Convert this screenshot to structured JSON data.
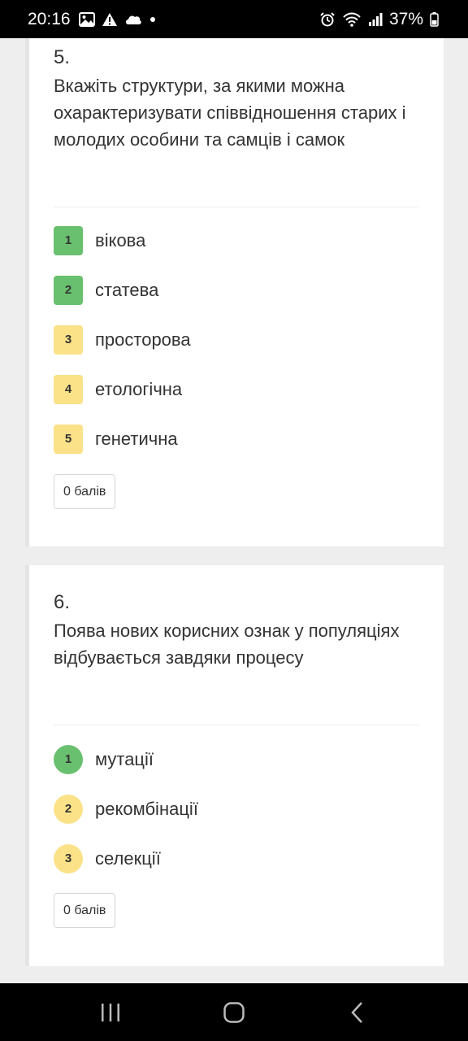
{
  "status_bar": {
    "time": "20:16",
    "battery": "37%",
    "left_icons": [
      "image-icon",
      "warning-icon",
      "cloud-icon",
      "dot-icon"
    ],
    "right_icons": [
      "alarm-icon",
      "wifi-icon",
      "signal-icon",
      "battery-icon"
    ]
  },
  "questions": [
    {
      "number": "5.",
      "text": "Вкажіть структури, за якими можна охарактеризувати співвідношення старих і молодих особини та самців і самок",
      "answers": [
        {
          "index": "1",
          "label": "вікова",
          "state": "correct"
        },
        {
          "index": "2",
          "label": "статева",
          "state": "correct"
        },
        {
          "index": "3",
          "label": "просторова",
          "state": "neutral"
        },
        {
          "index": "4",
          "label": "етологічна",
          "state": "neutral"
        },
        {
          "index": "5",
          "label": "генетична",
          "state": "neutral"
        }
      ],
      "score": "0 балів"
    },
    {
      "number": "6.",
      "text": "Поява нових корисних ознак у популяціях відбувається завдяки процесу",
      "answers": [
        {
          "index": "1",
          "label": "мутації",
          "state": "correct"
        },
        {
          "index": "2",
          "label": "рекомбінації",
          "state": "neutral"
        },
        {
          "index": "3",
          "label": "селекції",
          "state": "neutral"
        }
      ],
      "score": "0 балів"
    }
  ],
  "colors": {
    "correct": "#69c06e",
    "neutral": "#fbe289",
    "card_border": "#e4e4e4",
    "background": "#eeeeee"
  },
  "nav_bar": {
    "buttons": [
      "recent-apps-icon",
      "home-icon",
      "back-icon"
    ]
  }
}
